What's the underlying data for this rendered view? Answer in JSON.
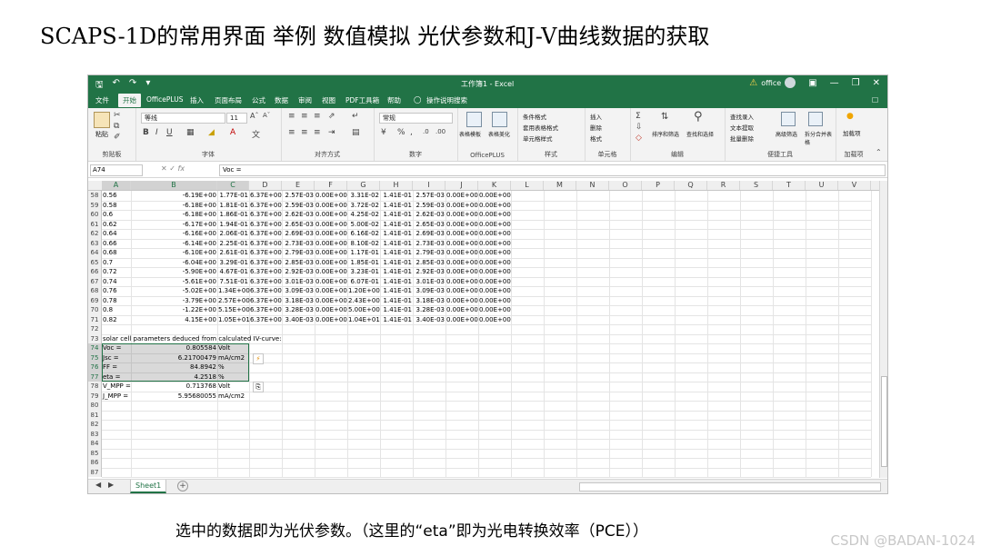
{
  "slide": {
    "title": "SCAPS-1D的常用界面 举例 数值模拟 光伏参数和J-V曲线数据的获取",
    "caption": "选中的数据即为光伏参数。（这里的“eta”即为光电转换效率（PCE））",
    "watermark": "CSDN @BADAN-1024"
  },
  "excel": {
    "window_title": "工作簿1 - Excel",
    "account": "office",
    "tabs": [
      "文件",
      "开始",
      "OfficePLUS",
      "插入",
      "页面布局",
      "公式",
      "数据",
      "审阅",
      "视图",
      "PDF工具箱",
      "帮助",
      "操作说明搜索"
    ],
    "active_tab": "开始",
    "ribbon": {
      "paste": "粘贴",
      "clipboard": "剪贴板",
      "font_name": "等线",
      "font_size": "11",
      "font_group": "字体",
      "align_group": "对齐方式",
      "number_format": "常规",
      "number_group": "数字",
      "table_template": "表格模板",
      "table_beautify": "表格美化",
      "officeplus_group": "OfficePLUS",
      "cond_format": "条件格式",
      "table_format": "套用表格格式",
      "cell_style": "单元格样式",
      "style_group": "样式",
      "insert": "插入",
      "delete": "删除",
      "format": "格式",
      "cells_group": "单元格",
      "sort_filter": "排序和筛选",
      "find_select": "查找和选择",
      "edit_group": "编辑",
      "find_insert": "查找录入",
      "text_extract": "文本提取",
      "batch_delete": "批量删除",
      "adv_filter": "高级筛选",
      "split_merge": "拆分合并表格",
      "tools_group": "便捷工具",
      "addin": "加载项",
      "addin_group": "加载项"
    },
    "name_box": "A74",
    "formula": "Voc =",
    "columns": [
      "A",
      "B",
      "C",
      "D",
      "E",
      "F",
      "G",
      "H",
      "I",
      "J",
      "K",
      "L",
      "M",
      "N",
      "O",
      "P",
      "Q",
      "R",
      "S",
      "T",
      "U",
      "V"
    ],
    "selected_columns": [
      "A",
      "B",
      "C"
    ],
    "rows": [
      {
        "n": "58",
        "a": "0.56",
        "b": "-6.19E+00",
        "c": "1.77E-01",
        "d": "6.37E+00",
        "e": "2.57E-03",
        "f": "0.00E+00",
        "g": "3.31E-02",
        "h": "1.41E-01",
        "i": "2.57E-03",
        "j": "0.00E+00",
        "k": "0.00E+00"
      },
      {
        "n": "59",
        "a": "0.58",
        "b": "-6.18E+00",
        "c": "1.81E-01",
        "d": "6.37E+00",
        "e": "2.59E-03",
        "f": "0.00E+00",
        "g": "3.72E-02",
        "h": "1.41E-01",
        "i": "2.59E-03",
        "j": "0.00E+00",
        "k": "0.00E+00"
      },
      {
        "n": "60",
        "a": "0.6",
        "b": "-6.18E+00",
        "c": "1.86E-01",
        "d": "6.37E+00",
        "e": "2.62E-03",
        "f": "0.00E+00",
        "g": "4.25E-02",
        "h": "1.41E-01",
        "i": "2.62E-03",
        "j": "0.00E+00",
        "k": "0.00E+00"
      },
      {
        "n": "61",
        "a": "0.62",
        "b": "-6.17E+00",
        "c": "1.94E-01",
        "d": "6.37E+00",
        "e": "2.65E-03",
        "f": "0.00E+00",
        "g": "5.00E-02",
        "h": "1.41E-01",
        "i": "2.65E-03",
        "j": "0.00E+00",
        "k": "0.00E+00"
      },
      {
        "n": "62",
        "a": "0.64",
        "b": "-6.16E+00",
        "c": "2.06E-01",
        "d": "6.37E+00",
        "e": "2.69E-03",
        "f": "0.00E+00",
        "g": "6.16E-02",
        "h": "1.41E-01",
        "i": "2.69E-03",
        "j": "0.00E+00",
        "k": "0.00E+00"
      },
      {
        "n": "63",
        "a": "0.66",
        "b": "-6.14E+00",
        "c": "2.25E-01",
        "d": "6.37E+00",
        "e": "2.73E-03",
        "f": "0.00E+00",
        "g": "8.10E-02",
        "h": "1.41E-01",
        "i": "2.73E-03",
        "j": "0.00E+00",
        "k": "0.00E+00"
      },
      {
        "n": "64",
        "a": "0.68",
        "b": "-6.10E+00",
        "c": "2.61E-01",
        "d": "6.37E+00",
        "e": "2.79E-03",
        "f": "0.00E+00",
        "g": "1.17E-01",
        "h": "1.41E-01",
        "i": "2.79E-03",
        "j": "0.00E+00",
        "k": "0.00E+00"
      },
      {
        "n": "65",
        "a": "0.7",
        "b": "-6.04E+00",
        "c": "3.29E-01",
        "d": "6.37E+00",
        "e": "2.85E-03",
        "f": "0.00E+00",
        "g": "1.85E-01",
        "h": "1.41E-01",
        "i": "2.85E-03",
        "j": "0.00E+00",
        "k": "0.00E+00"
      },
      {
        "n": "66",
        "a": "0.72",
        "b": "-5.90E+00",
        "c": "4.67E-01",
        "d": "6.37E+00",
        "e": "2.92E-03",
        "f": "0.00E+00",
        "g": "3.23E-01",
        "h": "1.41E-01",
        "i": "2.92E-03",
        "j": "0.00E+00",
        "k": "0.00E+00"
      },
      {
        "n": "67",
        "a": "0.74",
        "b": "-5.61E+00",
        "c": "7.51E-01",
        "d": "6.37E+00",
        "e": "3.01E-03",
        "f": "0.00E+00",
        "g": "6.07E-01",
        "h": "1.41E-01",
        "i": "3.01E-03",
        "j": "0.00E+00",
        "k": "0.00E+00"
      },
      {
        "n": "68",
        "a": "0.76",
        "b": "-5.02E+00",
        "c": "1.34E+00",
        "d": "6.37E+00",
        "e": "3.09E-03",
        "f": "0.00E+00",
        "g": "1.20E+00",
        "h": "1.41E-01",
        "i": "3.09E-03",
        "j": "0.00E+00",
        "k": "0.00E+00"
      },
      {
        "n": "69",
        "a": "0.78",
        "b": "-3.79E+00",
        "c": "2.57E+00",
        "d": "6.37E+00",
        "e": "3.18E-03",
        "f": "0.00E+00",
        "g": "2.43E+00",
        "h": "1.41E-01",
        "i": "3.18E-03",
        "j": "0.00E+00",
        "k": "0.00E+00"
      },
      {
        "n": "70",
        "a": "0.8",
        "b": "-1.22E+00",
        "c": "5.15E+00",
        "d": "6.37E+00",
        "e": "3.28E-03",
        "f": "0.00E+00",
        "g": "5.00E+00",
        "h": "1.41E-01",
        "i": "3.28E-03",
        "j": "0.00E+00",
        "k": "0.00E+00"
      },
      {
        "n": "71",
        "a": "0.82",
        "b": "4.15E+00",
        "c": "1.05E+01",
        "d": "6.37E+00",
        "e": "3.40E-03",
        "f": "0.00E+00",
        "g": "1.04E+01",
        "h": "1.41E-01",
        "i": "3.40E-03",
        "j": "0.00E+00",
        "k": "0.00E+00"
      },
      {
        "n": "72"
      },
      {
        "n": "73",
        "note": "solar cell parameters deduced from calculated IV-curve:"
      },
      {
        "n": "74",
        "pa": "Voc =",
        "pb": "0.805584",
        "pc": "Volt"
      },
      {
        "n": "75",
        "pa": "Jsc =",
        "pb": "6.21700479",
        "pc": "mA/cm2"
      },
      {
        "n": "76",
        "pa": "FF =",
        "pb": "84.8942",
        "pc": "%"
      },
      {
        "n": "77",
        "pa": "eta =",
        "pb": "4.2518",
        "pc": "%"
      },
      {
        "n": "78",
        "pa": "V_MPP =",
        "pb": "0.713768",
        "pc": "Volt"
      },
      {
        "n": "79",
        "pa": "J_MPP =",
        "pb": "5.95680055",
        "pc": "mA/cm2"
      },
      {
        "n": "80"
      },
      {
        "n": "81"
      },
      {
        "n": "82"
      },
      {
        "n": "83"
      },
      {
        "n": "84"
      },
      {
        "n": "85"
      },
      {
        "n": "86"
      },
      {
        "n": "87"
      }
    ],
    "selected_rows": [
      "74",
      "75",
      "76",
      "77"
    ],
    "sheet_tab": "Sheet1"
  }
}
